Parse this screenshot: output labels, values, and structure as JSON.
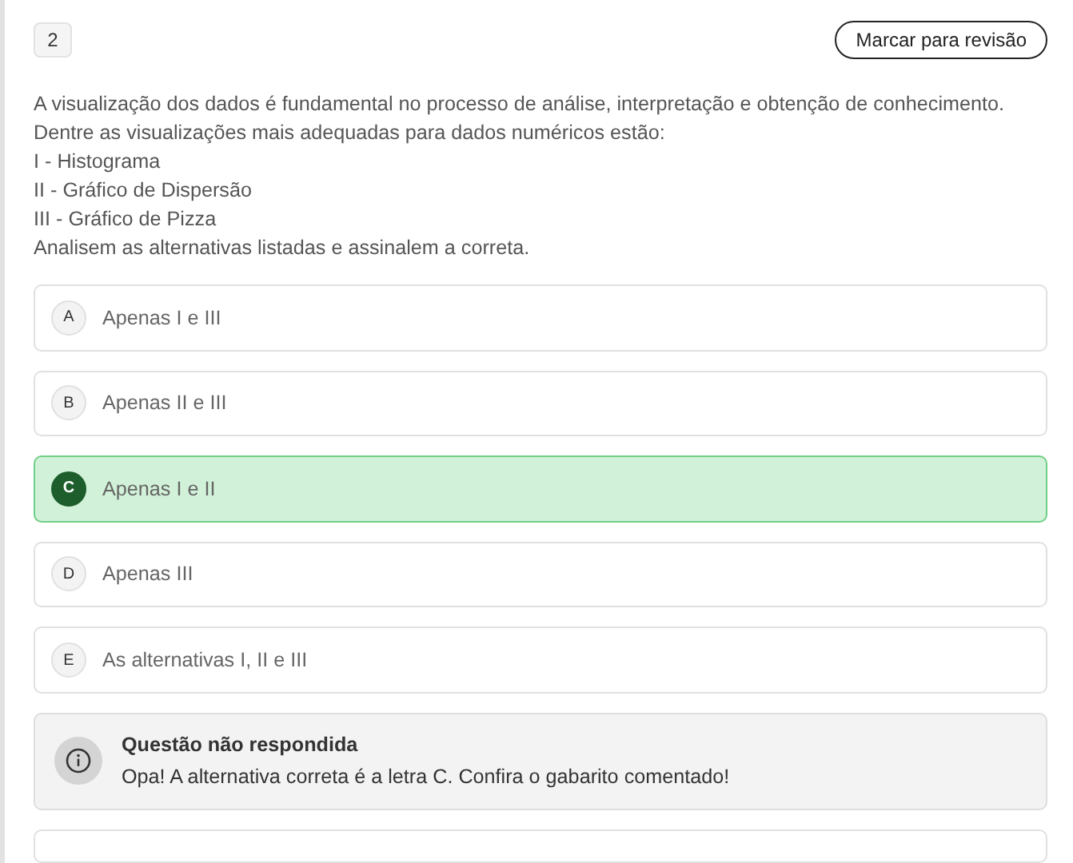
{
  "question": {
    "number": "2",
    "review_button": "Marcar para revisão",
    "lines": [
      "A visualização dos dados é fundamental no processo de análise, interpretação e obtenção de conhecimento.",
      "Dentre as visualizações mais adequadas para dados numéricos estão:",
      "I - Histograma",
      "II - Gráfico de Dispersão",
      "III - Gráfico de Pizza",
      "Analisem as alternativas listadas e assinalem a correta."
    ]
  },
  "options": [
    {
      "letter": "A",
      "text": "Apenas I e III",
      "selected": false
    },
    {
      "letter": "B",
      "text": "Apenas II e III",
      "selected": false
    },
    {
      "letter": "C",
      "text": "Apenas I e II",
      "selected": true
    },
    {
      "letter": "D",
      "text": "Apenas III",
      "selected": false
    },
    {
      "letter": "E",
      "text": "As alternativas I, II e III",
      "selected": false
    }
  ],
  "feedback": {
    "title": "Questão não respondida",
    "message": "Opa! A alternativa correta é a letra C. Confira o gabarito comentado!"
  }
}
